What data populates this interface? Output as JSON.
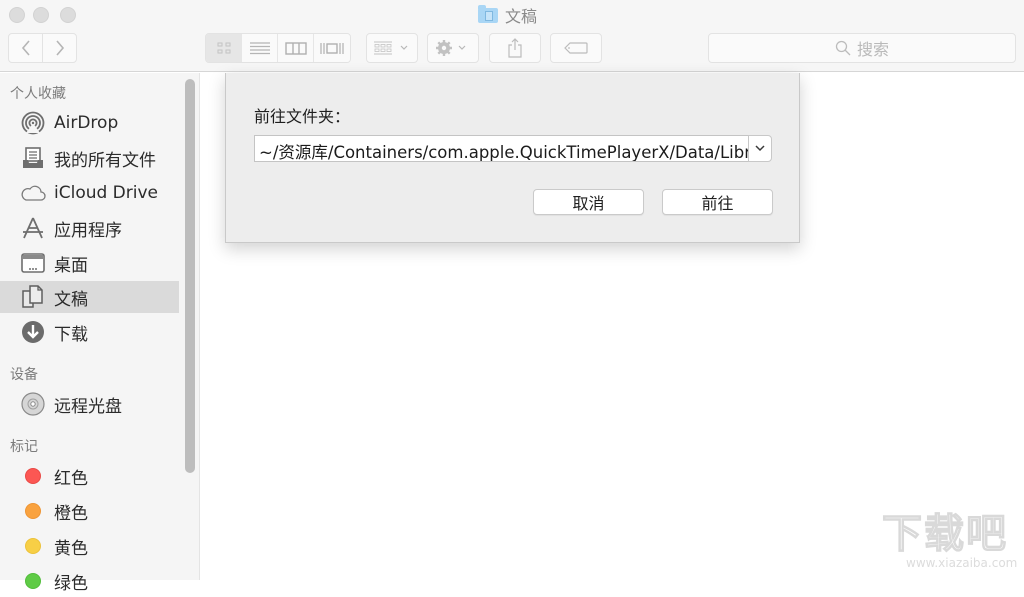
{
  "window": {
    "title": "文稿",
    "title_icon": "documents-folder-icon"
  },
  "toolbar": {
    "back": "back-chevron-icon",
    "forward": "forward-chevron-icon",
    "view_modes": [
      {
        "name": "icon-view",
        "glyph": "▫▫",
        "active": true
      },
      {
        "name": "list-view",
        "glyph": "≡",
        "active": false
      },
      {
        "name": "column-view",
        "glyph": "▥",
        "active": false
      },
      {
        "name": "cover-flow-view",
        "glyph": "▯",
        "active": false
      }
    ],
    "arrange_glyph": "▦ ⌄",
    "action_glyph": "⚙ ⌄",
    "share_glyph": "⇪",
    "tag_glyph": "⬭",
    "search_placeholder": "搜索"
  },
  "sidebar": {
    "sections": [
      {
        "title": "个人收藏",
        "items": [
          {
            "label": "AirDrop",
            "icon": "airdrop-icon"
          },
          {
            "label": "我的所有文件",
            "icon": "all-files-icon"
          },
          {
            "label": "iCloud Drive",
            "icon": "cloud-icon"
          },
          {
            "label": "应用程序",
            "icon": "applications-icon"
          },
          {
            "label": "桌面",
            "icon": "desktop-icon"
          },
          {
            "label": "文稿",
            "icon": "documents-icon",
            "selected": true
          },
          {
            "label": "下载",
            "icon": "download-icon"
          }
        ]
      },
      {
        "title": "设备",
        "items": [
          {
            "label": "远程光盘",
            "icon": "disc-icon"
          }
        ]
      },
      {
        "title": "标记",
        "items": [
          {
            "label": "红色",
            "color": "#fc5753"
          },
          {
            "label": "橙色",
            "color": "#f9a23f"
          },
          {
            "label": "黄色",
            "color": "#f7cf46"
          },
          {
            "label": "绿色",
            "color": "#5fcb46"
          }
        ]
      }
    ]
  },
  "dialog": {
    "label": "前往文件夹：",
    "path_value": "~/资源库/Containers/com.apple.QuickTimePlayerX/Data/Library",
    "cancel_label": "取消",
    "go_label": "前往"
  },
  "watermark": {
    "big": "下载吧",
    "small": "www.xiazaiba.com"
  }
}
